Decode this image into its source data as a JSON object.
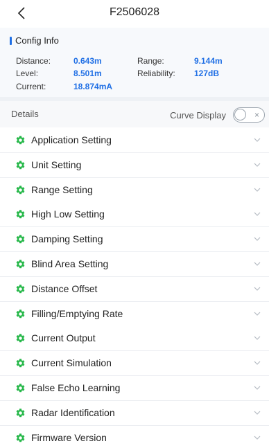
{
  "header": {
    "title": "F2506028"
  },
  "config": {
    "title": "Config Info",
    "distance_label": "Distance:",
    "distance_value": "0.643m",
    "range_label": "Range:",
    "range_value": "9.144m",
    "level_label": "Level:",
    "level_value": "8.501m",
    "reliability_label": "Reliability:",
    "reliability_value": "127dB",
    "current_label": "Current:",
    "current_value": "18.874mA"
  },
  "details": {
    "label": "Details",
    "curve_display_label": "Curve Display",
    "curve_display_on": false,
    "toggle_off_glyph": "×"
  },
  "settings": {
    "items": [
      "Application Setting",
      "Unit Setting",
      "Range Setting",
      "High Low Setting",
      "Damping Setting",
      "Blind Area Setting",
      "Distance Offset",
      "Filling/Emptying Rate",
      "Current Output",
      "Current Simulation",
      "False Echo Learning",
      "Radar Identification",
      "Firmware Version"
    ]
  },
  "colors": {
    "accent_blue": "#1f6fe5",
    "gear_green": "#27b84a"
  }
}
